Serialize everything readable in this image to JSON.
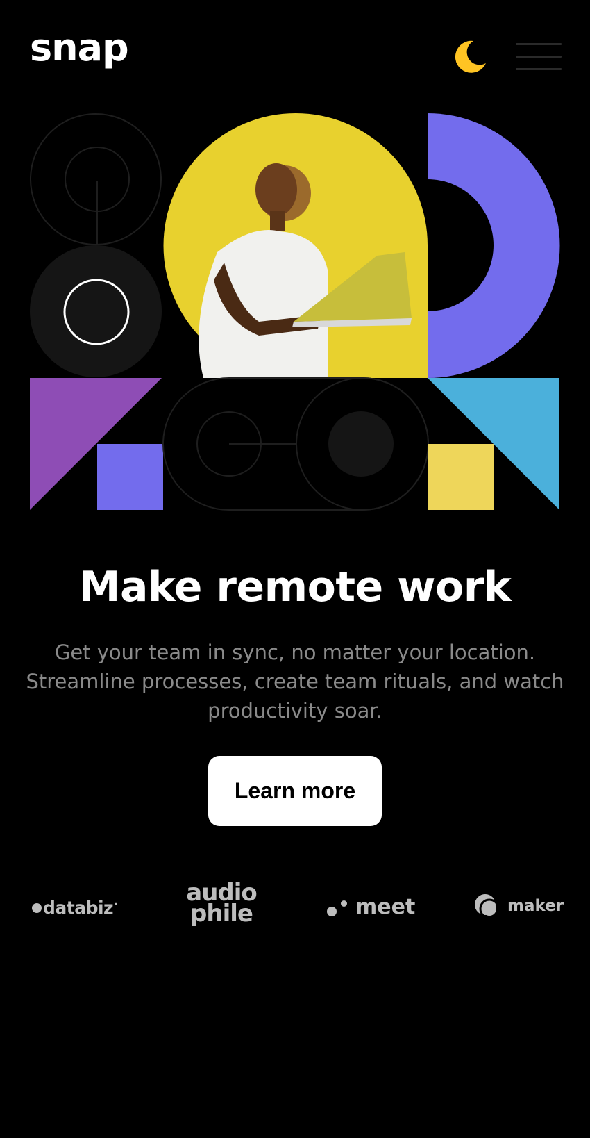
{
  "brand": {
    "logo_text": "snap"
  },
  "header": {
    "theme_toggle_icon": "moon-icon",
    "menu_icon": "hamburger-icon",
    "accent_moon": "#FFC423"
  },
  "hero": {
    "title": "Make remote work",
    "description": "Get your team in sync, no matter your location. Streamline processes, create team rituals, and watch productivity soar.",
    "cta_label": "Learn more"
  },
  "clients": [
    {
      "name": "databiz"
    },
    {
      "name": "audiophile",
      "line1": "audio",
      "line2": "phile"
    },
    {
      "name": "meet"
    },
    {
      "name": "maker"
    }
  ],
  "colors": {
    "background": "#000000",
    "yellow": "#E8D12E",
    "violet": "#736CED",
    "purple": "#8E4DB5",
    "blue": "#4BB0DB",
    "light_yellow": "#EED65A",
    "outline": "#1E1E1E",
    "dark_fill": "#151515"
  }
}
